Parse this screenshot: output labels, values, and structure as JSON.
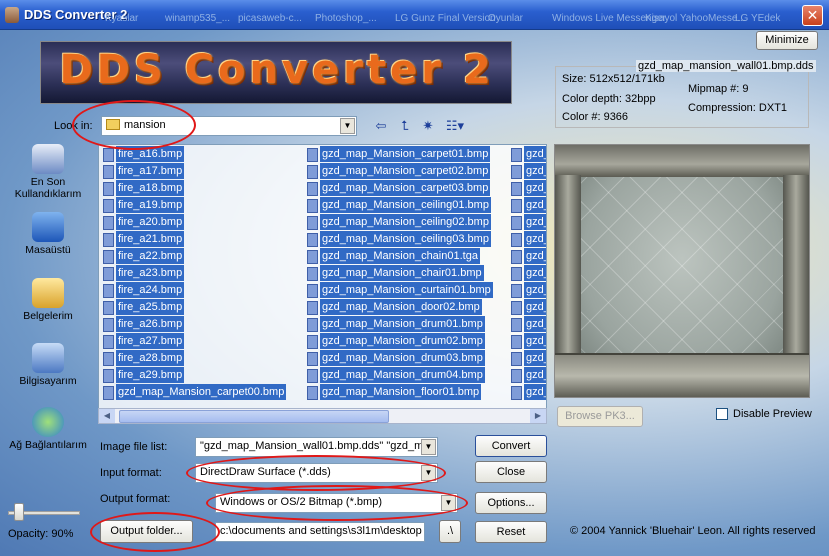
{
  "window": {
    "title": "DDS Converter 2",
    "close_glyph": "✕",
    "minimize_label": "Minimize"
  },
  "desktop_titles": [
    "Kyaslar",
    "winamp535_...",
    "picasaweb-c...",
    "Photoshop_...",
    "LG Gunz Final Version",
    "Oyunlar",
    "Windows Live Messenger",
    "Kisayol YahooMesse...",
    "LG YEdek"
  ],
  "banner": {
    "text": "DDS Converter 2"
  },
  "look_in": {
    "label": "Look in:",
    "value": "mansion",
    "icons": [
      "back-arrow-icon",
      "up-folder-icon",
      "new-folder-icon",
      "view-menu-icon"
    ]
  },
  "places": [
    {
      "label": "En Son Kullandıklarım",
      "icon": "recent-documents-icon"
    },
    {
      "label": "Masaüstü",
      "icon": "desktop-icon"
    },
    {
      "label": "Belgelerim",
      "icon": "my-documents-icon"
    },
    {
      "label": "Bilgisayarım",
      "icon": "my-computer-icon"
    },
    {
      "label": "Ağ Bağlantılarım",
      "icon": "network-icon"
    }
  ],
  "files": {
    "col1": [
      "fire_a16.bmp",
      "fire_a17.bmp",
      "fire_a18.bmp",
      "fire_a19.bmp",
      "fire_a20.bmp",
      "fire_a21.bmp",
      "fire_a22.bmp",
      "fire_a23.bmp",
      "fire_a24.bmp",
      "fire_a25.bmp",
      "fire_a26.bmp",
      "fire_a27.bmp",
      "fire_a28.bmp",
      "fire_a29.bmp",
      "gzd_map_Mansion_carpet00.bmp"
    ],
    "col2": [
      "gzd_map_Mansion_carpet01.bmp",
      "gzd_map_Mansion_carpet02.bmp",
      "gzd_map_Mansion_carpet03.bmp",
      "gzd_map_Mansion_ceiling01.bmp",
      "gzd_map_Mansion_ceiling02.bmp",
      "gzd_map_Mansion_ceiling03.bmp",
      "gzd_map_Mansion_chain01.tga",
      "gzd_map_Mansion_chair01.bmp",
      "gzd_map_Mansion_curtain01.bmp",
      "gzd_map_Mansion_door02.bmp",
      "gzd_map_Mansion_drum01.bmp",
      "gzd_map_Mansion_drum02.bmp",
      "gzd_map_Mansion_drum03.bmp",
      "gzd_map_Mansion_drum04.bmp",
      "gzd_map_Mansion_floor01.bmp"
    ],
    "col3": [
      "gzd_",
      "gzd_",
      "gzd_",
      "gzd_",
      "gzd_",
      "gzd_",
      "gzd_",
      "gzd_",
      "gzd_",
      "gzd_",
      "gzd_",
      "gzd_",
      "gzd_",
      "gzd_",
      "gzd_"
    ]
  },
  "info": {
    "filename": "gzd_map_mansion_wall01.bmp.dds",
    "size": "Size: 512x512/171kb",
    "mipmap": "Mipmap #: 9",
    "color_depth": "Color depth: 32bpp",
    "compression": "Compression: DXT1",
    "color_count": "Color #: 9366"
  },
  "form": {
    "image_list_label": "Image file list:",
    "image_list_value": "\"gzd_map_Mansion_wall01.bmp.dds\" \"gzd_ma",
    "input_format_label": "Input format:",
    "input_format_value": "DirectDraw Surface (*.dds)",
    "output_format_label": "Output format:",
    "output_format_value": "Windows or OS/2 Bitmap (*.bmp)",
    "output_folder_button": "Output folder...",
    "output_folder_value": "c:\\documents and settings\\s3l1m\\desktop",
    "dots_button": ".\\"
  },
  "buttons": {
    "convert": "Convert",
    "close": "Close",
    "options": "Options...",
    "reset": "Reset",
    "browse_pk3": "Browse PK3...",
    "disable_preview": "Disable Preview"
  },
  "opacity": {
    "label": "Opacity: 90%",
    "value": 0.9
  },
  "copyright": "© 2004 Yannick 'Bluehair' Leon. All rights reserved",
  "colors": {
    "selection": "#316ac5",
    "titlebar": "#2a5fcf",
    "annotation": "#e01818"
  }
}
